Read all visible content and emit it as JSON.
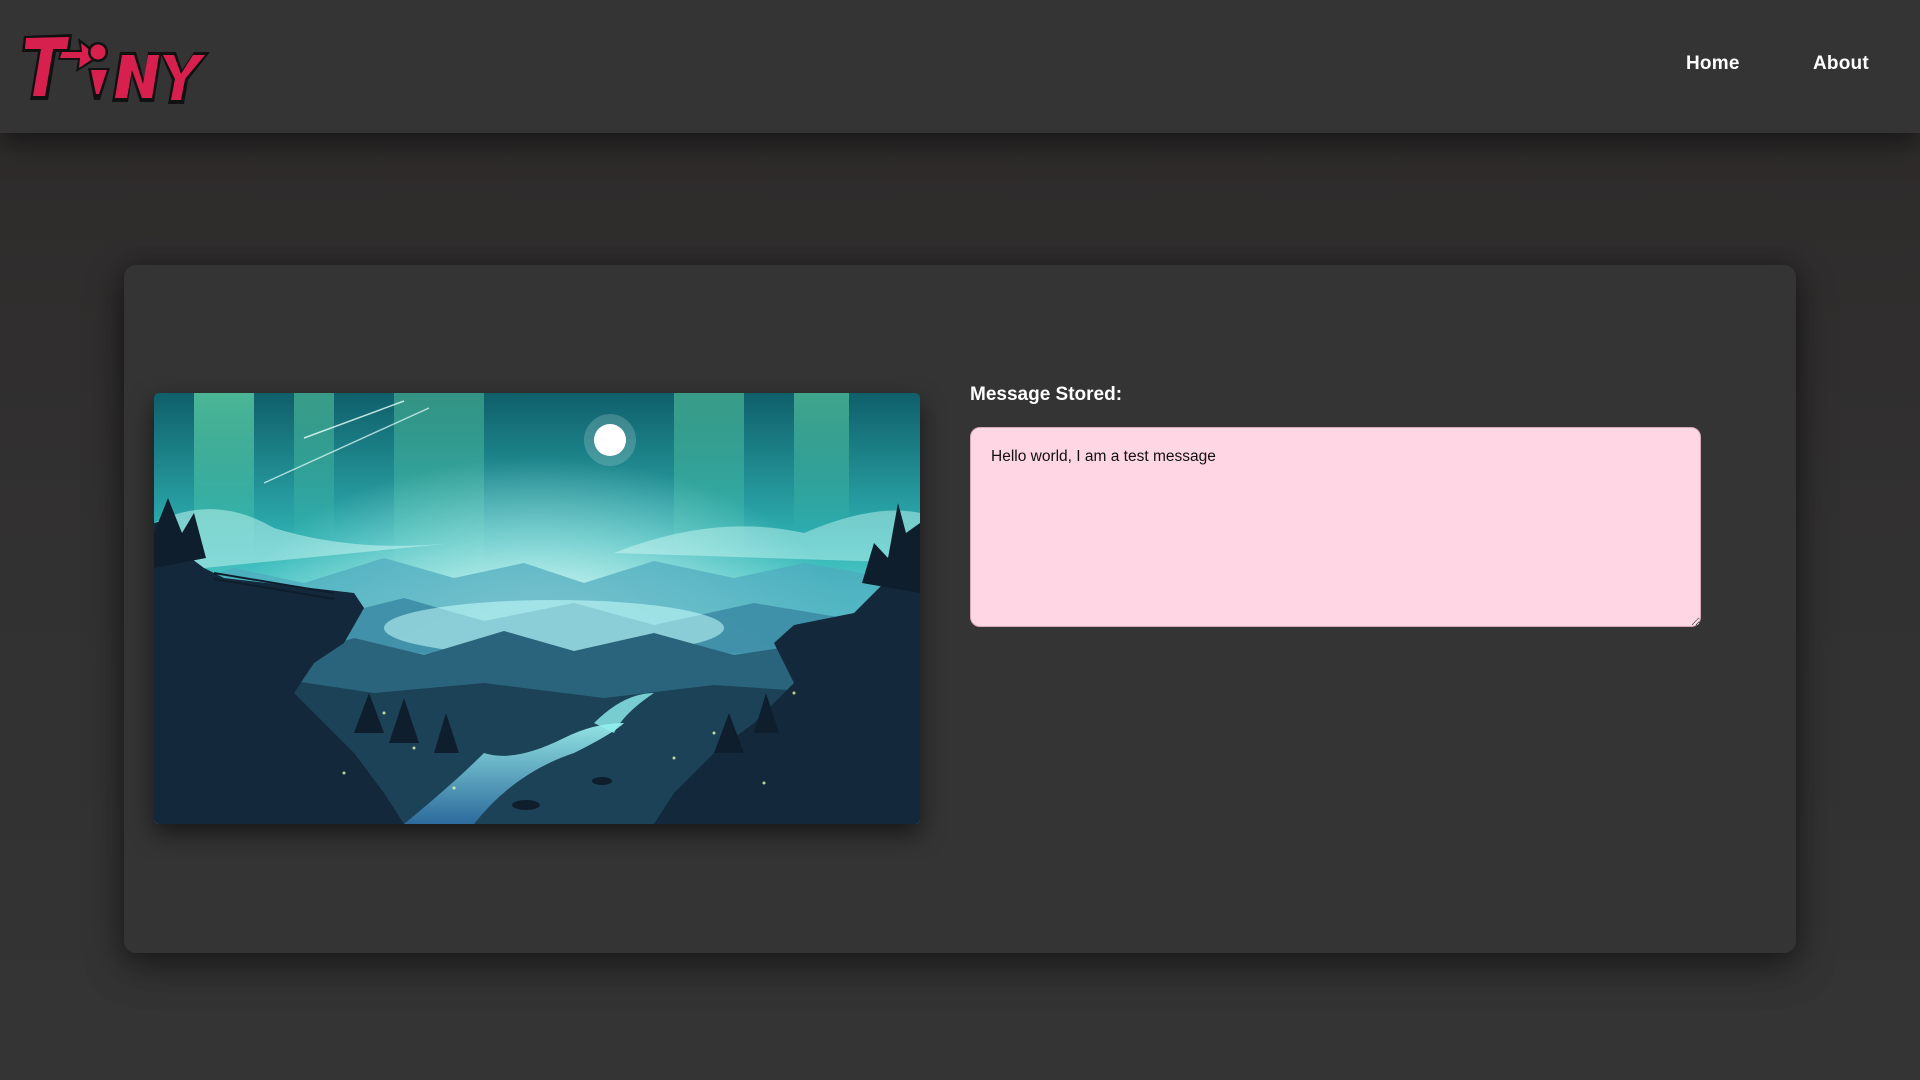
{
  "logo": {
    "text": "TiNY",
    "icon": "arrow-right-icon",
    "colors": {
      "primary": "#d8204f",
      "outline": "#111111"
    }
  },
  "nav": {
    "home_label": "Home",
    "about_label": "About"
  },
  "message": {
    "label": "Message Stored:",
    "value": "Hello world, I am a test message"
  },
  "image": {
    "subject": "aurora-night-landscape"
  },
  "colors": {
    "navbar": "#343434",
    "background": "#333232",
    "card": "#343434",
    "textarea": "#ffd6e4",
    "text": "#ffffff"
  }
}
